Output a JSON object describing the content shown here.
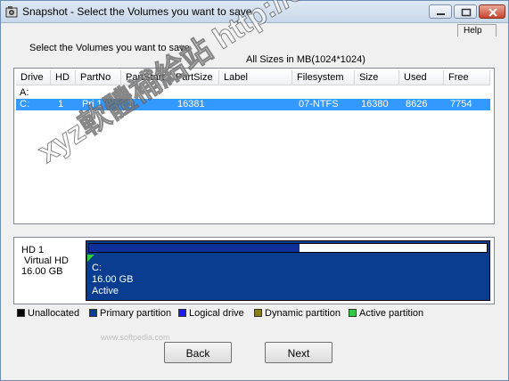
{
  "window": {
    "title": "Snapshot - Select the Volumes you want to save",
    "help_label": "Help"
  },
  "instruction": "Select the Volumes you want to save",
  "sizes_note": "All Sizes in MB(1024*1024)",
  "table": {
    "columns": [
      "Drive",
      "HD",
      "PartNo",
      "PartStart",
      "PartSize",
      "Label",
      "Filesystem",
      "Size",
      "Used",
      "Free"
    ],
    "rows": [
      {
        "drive": "A:",
        "hd": "",
        "partno": "",
        "partstart": "",
        "partsize": "",
        "label": "",
        "filesystem": "",
        "size": "",
        "used": "",
        "free": "",
        "selected": false
      },
      {
        "drive": "C:",
        "hd": "1",
        "partno": "Pri  1",
        "partstart": "1",
        "partsize": "16381",
        "label": "",
        "filesystem": "07-NTFS",
        "size": "16380",
        "used": "8626",
        "free": "7754",
        "selected": true
      }
    ]
  },
  "disk": {
    "name": "HD 1",
    "type": "Virtual HD",
    "capacity": "16.00 GB",
    "partition": {
      "drive": "C:",
      "size_text": "16.00 GB",
      "status": "Active",
      "used_fraction": 0.53
    }
  },
  "legend": [
    {
      "label": "Unallocated",
      "color": "#000000"
    },
    {
      "label": "Primary partition",
      "color": "#0a3d8f"
    },
    {
      "label": "Logical drive",
      "color": "#1a1aff"
    },
    {
      "label": "Dynamic partition",
      "color": "#8b7d1a"
    },
    {
      "label": "Active partition",
      "color": "#2ecc40"
    }
  ],
  "watermark_small": "www.softpedia.com",
  "watermark_overlay": "xyz軟體補給站 http://31.to",
  "buttons": {
    "back": "Back",
    "next": "Next"
  }
}
